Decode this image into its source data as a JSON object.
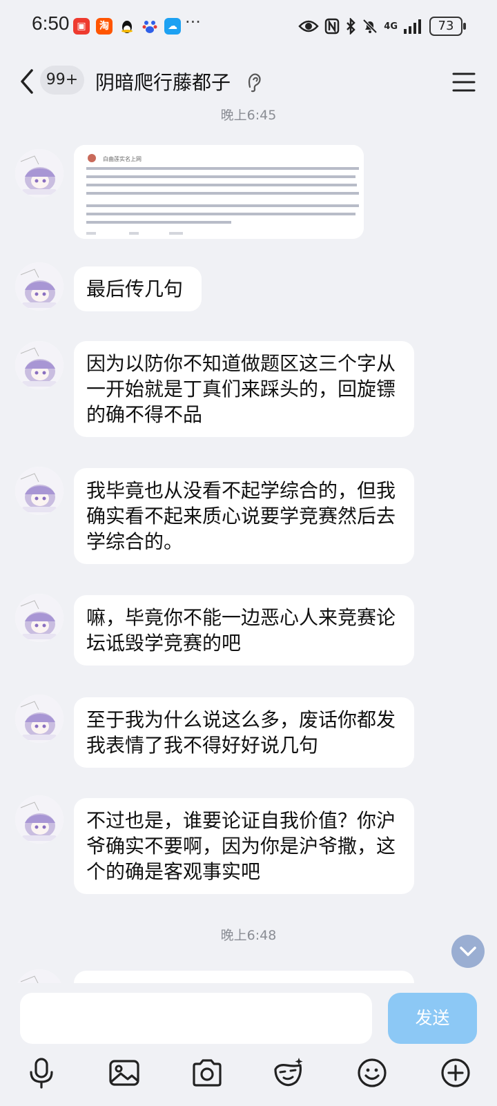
{
  "status_bar": {
    "time": "6:50",
    "battery": "73",
    "network": "4G",
    "app_icons": [
      "taobao-red-icon",
      "taobao-icon",
      "qq-icon",
      "baidu-icon",
      "cloud-icon"
    ],
    "overflow": "···"
  },
  "header": {
    "unread_badge": "99+",
    "title": "阴暗爬行藤都子"
  },
  "chat": {
    "timestamp_top": "晚上6:45",
    "image_message": {
      "author_line": "白曲莲实名上网"
    },
    "messages": [
      {
        "text": "最后传几句"
      },
      {
        "text": "因为以防你不知道做题区这三个字从一开始就是丁真们来踩头的，回旋镖的确不得不品"
      },
      {
        "text": "我毕竟也从没看不起学综合的，但我确实看不起来质心说要学竞赛然后去学综合的。"
      },
      {
        "text": "嘛，毕竟你不能一边恶心人来竞赛论坛诋毁学竞赛的吧"
      },
      {
        "text": "至于我为什么说这么多，废话你都发我表情了我不得好好说几句"
      },
      {
        "text": "不过也是，谁要论证自我价值？你沪爷确实不要啊，因为你是沪爷撒，这个的确是客观事实吧"
      }
    ],
    "timestamp_bottom": "晚上6:48"
  },
  "input": {
    "send_label": "发送",
    "toolbar": [
      "microphone-icon",
      "image-icon",
      "camera-icon",
      "sticker-icon",
      "emoji-icon",
      "plus-icon"
    ]
  },
  "colors": {
    "background": "#f0f1f5",
    "bubble": "#ffffff",
    "send_button": "#8cc8f5",
    "timestamp": "#8a8d94"
  }
}
